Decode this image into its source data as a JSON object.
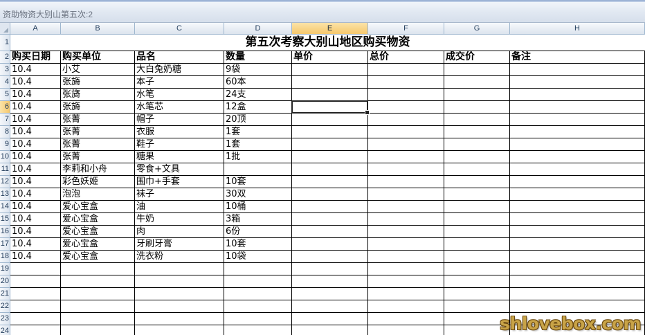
{
  "window": {
    "title": "资助物资大别山第五次:2"
  },
  "columns": [
    "A",
    "B",
    "C",
    "D",
    "E",
    "F",
    "G",
    "H"
  ],
  "row_numbers": [
    "1",
    "2",
    "3",
    "4",
    "5",
    "6",
    "7",
    "8",
    "9",
    "10",
    "11",
    "12",
    "13",
    "14",
    "15",
    "16",
    "17",
    "18",
    "19",
    "20",
    "21",
    "22",
    "23",
    "24"
  ],
  "selected": {
    "column": "E",
    "row": "6"
  },
  "sheet": {
    "title": "第五次考察大别山地区购买物资",
    "headers": [
      "购买日期",
      "购买单位",
      "品名",
      "数量",
      "单价",
      "总价",
      "成交价",
      "备注"
    ],
    "rows": [
      [
        "10.4",
        "小艾",
        "大白兔奶糖",
        "9袋",
        "",
        "",
        "",
        ""
      ],
      [
        "10.4",
        "张旖",
        "本子",
        "60本",
        "",
        "",
        "",
        ""
      ],
      [
        "10.4",
        "张旖",
        "水笔",
        "24支",
        "",
        "",
        "",
        ""
      ],
      [
        "10.4",
        "张旖",
        "水笔芯",
        "12盒",
        "",
        "",
        "",
        ""
      ],
      [
        "10.4",
        "张菁",
        "帽子",
        "20顶",
        "",
        "",
        "",
        ""
      ],
      [
        "10.4",
        "张菁",
        "衣服",
        "1套",
        "",
        "",
        "",
        ""
      ],
      [
        "10.4",
        "张菁",
        "鞋子",
        "1套",
        "",
        "",
        "",
        ""
      ],
      [
        "10.4",
        "张菁",
        "糖果",
        "1批",
        "",
        "",
        "",
        ""
      ],
      [
        "10.4",
        "李莉和小舟",
        "零食+文具",
        "",
        "",
        "",
        "",
        ""
      ],
      [
        "10.4",
        "彩色妖姬",
        "围巾+手套",
        "10套",
        "",
        "",
        "",
        ""
      ],
      [
        "10.4",
        "泡泡",
        "袜子",
        "30双",
        "",
        "",
        "",
        ""
      ],
      [
        "10.4",
        "爱心宝盒",
        "油",
        "10桶",
        "",
        "",
        "",
        ""
      ],
      [
        "10.4",
        "爱心宝盒",
        "牛奶",
        "3箱",
        "",
        "",
        "",
        ""
      ],
      [
        "10.4",
        "爱心宝盒",
        "肉",
        "6份",
        "",
        "",
        "",
        ""
      ],
      [
        "10.4",
        "爱心宝盒",
        "牙刷牙膏",
        "10套",
        "",
        "",
        "",
        ""
      ],
      [
        "10.4",
        "爱心宝盒",
        "洗衣粉",
        "10袋",
        "",
        "",
        "",
        ""
      ],
      [
        "",
        "",
        "",
        "",
        "",
        "",
        "",
        ""
      ],
      [
        "",
        "",
        "",
        "",
        "",
        "",
        "",
        ""
      ],
      [
        "",
        "",
        "",
        "",
        "",
        "",
        "",
        ""
      ],
      [
        "",
        "",
        "",
        "",
        "",
        "",
        "",
        ""
      ],
      [
        "",
        "",
        "",
        "",
        "",
        "",
        "",
        ""
      ],
      [
        "",
        "",
        "",
        "",
        "",
        "",
        "",
        ""
      ]
    ]
  },
  "watermark": "shlovebox.com"
}
